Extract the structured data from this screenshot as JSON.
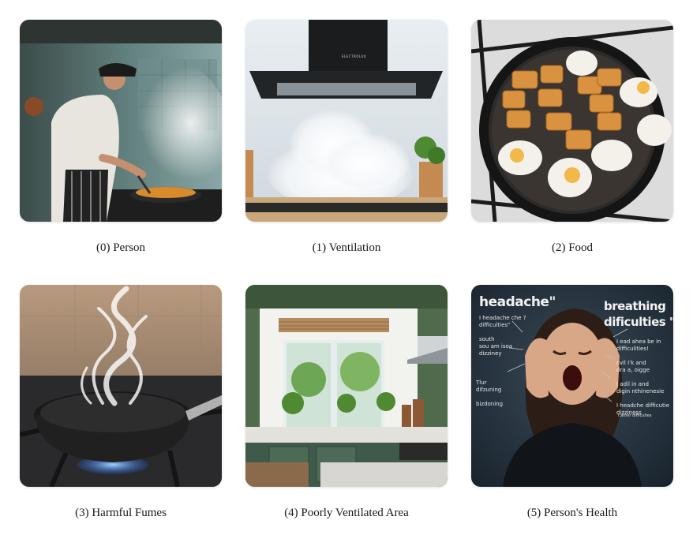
{
  "panels": [
    {
      "caption": "(0) Person",
      "icon": "person-cooking-image"
    },
    {
      "caption": "(1) Ventilation",
      "icon": "range-hood-image"
    },
    {
      "caption": "(2) Food",
      "icon": "frying-pan-food-image"
    },
    {
      "caption": "(3) Harmful Fumes",
      "icon": "smoking-pan-image"
    },
    {
      "caption": "(4) Poorly Ventilated Area",
      "icon": "kitchen-window-image"
    },
    {
      "caption": "(5) Person's Health",
      "icon": "distressed-person-image"
    }
  ],
  "health_image": {
    "heading_left": "headache\"",
    "heading_right_line1": "breathing",
    "heading_right_line2": "dificulties \"",
    "notes_left": "I headache che ?\ndifficulties\"\n\nsouth\nsou am isoa\ndizziney",
    "notes_left2": "Tlur\ndifzuning\n\nbizdoning",
    "notes_right": "I ead ahea be in\ndifficulities!\n\ncvil I'k and\ndra a, oigge\n\nI adil in and\ndigin nthinenesie\n\nI headche difficutie\ndizziness",
    "notes_bottom": "r.ather difficultes"
  },
  "hood_brand": "ELECTROLUX"
}
